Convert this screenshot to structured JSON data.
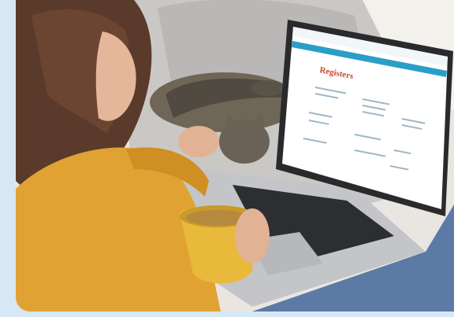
{
  "scene": {
    "description_icon": "photo-woman-laptop-cat",
    "background_color": "#d7e8f4"
  },
  "laptop_screen": {
    "logo": "",
    "page_title": "Registers",
    "accent_color": "#2a9ec8",
    "title_color": "#c84a33"
  }
}
